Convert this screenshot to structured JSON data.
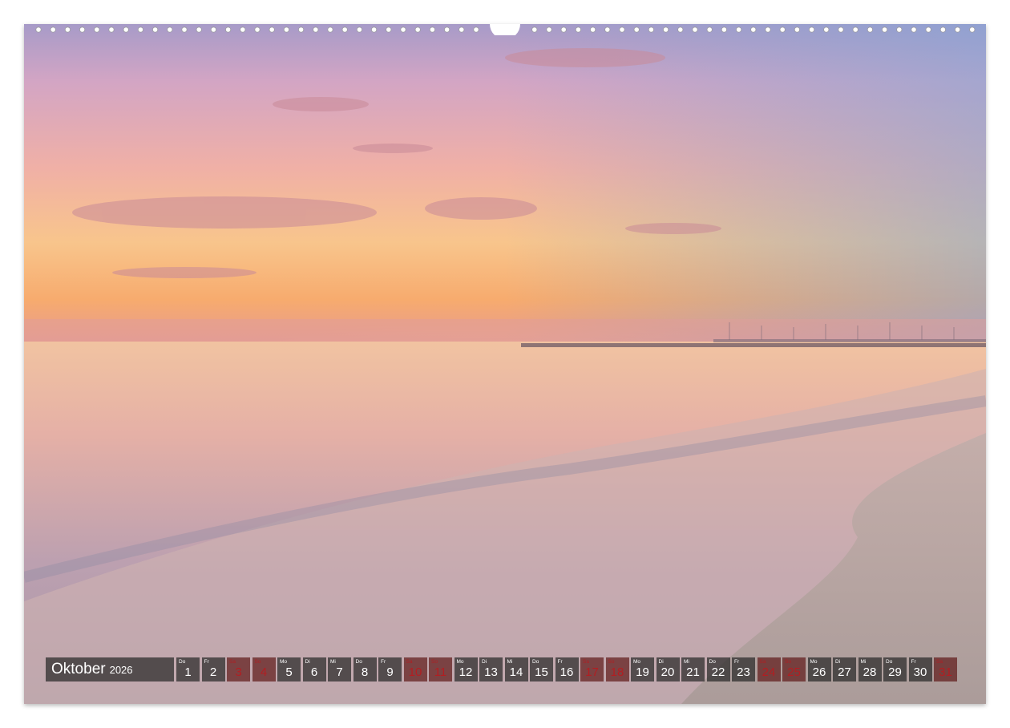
{
  "calendar": {
    "month": "Oktober",
    "year": "2026",
    "days": [
      {
        "wd": "Do",
        "n": "1",
        "red": false
      },
      {
        "wd": "Fr",
        "n": "2",
        "red": false
      },
      {
        "wd": "Sa",
        "n": "3",
        "red": true
      },
      {
        "wd": "So",
        "n": "4",
        "red": true
      },
      {
        "wd": "Mo",
        "n": "5",
        "red": false
      },
      {
        "wd": "Di",
        "n": "6",
        "red": false
      },
      {
        "wd": "Mi",
        "n": "7",
        "red": false
      },
      {
        "wd": "Do",
        "n": "8",
        "red": false
      },
      {
        "wd": "Fr",
        "n": "9",
        "red": false
      },
      {
        "wd": "Sa",
        "n": "10",
        "red": true
      },
      {
        "wd": "So",
        "n": "11",
        "red": true
      },
      {
        "wd": "Mo",
        "n": "12",
        "red": false
      },
      {
        "wd": "Di",
        "n": "13",
        "red": false
      },
      {
        "wd": "Mi",
        "n": "14",
        "red": false
      },
      {
        "wd": "Do",
        "n": "15",
        "red": false
      },
      {
        "wd": "Fr",
        "n": "16",
        "red": false
      },
      {
        "wd": "Sa",
        "n": "17",
        "red": true
      },
      {
        "wd": "So",
        "n": "18",
        "red": true
      },
      {
        "wd": "Mo",
        "n": "19",
        "red": false
      },
      {
        "wd": "Di",
        "n": "20",
        "red": false
      },
      {
        "wd": "Mi",
        "n": "21",
        "red": false
      },
      {
        "wd": "Do",
        "n": "22",
        "red": false
      },
      {
        "wd": "Fr",
        "n": "23",
        "red": false
      },
      {
        "wd": "Sa",
        "n": "24",
        "red": true
      },
      {
        "wd": "So",
        "n": "25",
        "red": true
      },
      {
        "wd": "Mo",
        "n": "26",
        "red": false
      },
      {
        "wd": "Di",
        "n": "27",
        "red": false
      },
      {
        "wd": "Mi",
        "n": "28",
        "red": false
      },
      {
        "wd": "Do",
        "n": "29",
        "red": false
      },
      {
        "wd": "Fr",
        "n": "30",
        "red": false
      },
      {
        "wd": "Sa",
        "n": "31",
        "red": true
      }
    ]
  },
  "colors": {
    "weekend_text": "#b21e22",
    "cell_background": "#282828"
  }
}
